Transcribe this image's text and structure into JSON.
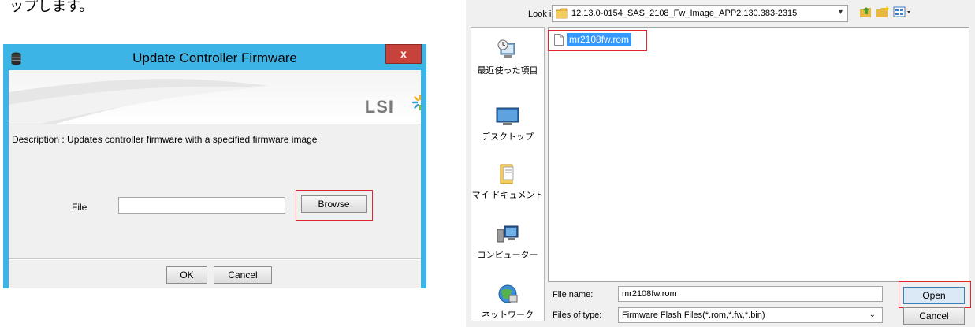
{
  "page": {
    "top_fragment": "ップします。"
  },
  "update_dialog": {
    "title": "Update Controller Firmware",
    "close_label": "x",
    "logo_text": "LSI",
    "description": "Description : Updates controller firmware with a specified firmware image",
    "file_label": "File",
    "file_value": "",
    "browse_label": "Browse",
    "ok_label": "OK",
    "cancel_label": "Cancel",
    "colors": {
      "titlebar": "#3db4e6",
      "close": "#c7423a",
      "highlight": "#e0252c"
    }
  },
  "file_dialog": {
    "look_in_label": "Look in:",
    "look_in_value": "12.13.0-0154_SAS_2108_Fw_Image_APP2.130.383-2315",
    "places": [
      {
        "label": "最近使った項目",
        "icon": "recent-places-icon"
      },
      {
        "label": "デスクトップ",
        "icon": "desktop-icon"
      },
      {
        "label": "マイ ドキュメント",
        "icon": "my-documents-icon"
      },
      {
        "label": "コンピューター",
        "icon": "computer-icon"
      },
      {
        "label": "ネットワーク",
        "icon": "network-icon"
      }
    ],
    "files": [
      "mr2108fw.rom"
    ],
    "file_name_label": "File name:",
    "file_name_value": "mr2108fw.rom",
    "file_type_label": "Files of type:",
    "file_type_value": "Firmware Flash Files(*.rom,*.fw,*.bin)",
    "open_label": "Open",
    "cancel_label": "Cancel"
  }
}
